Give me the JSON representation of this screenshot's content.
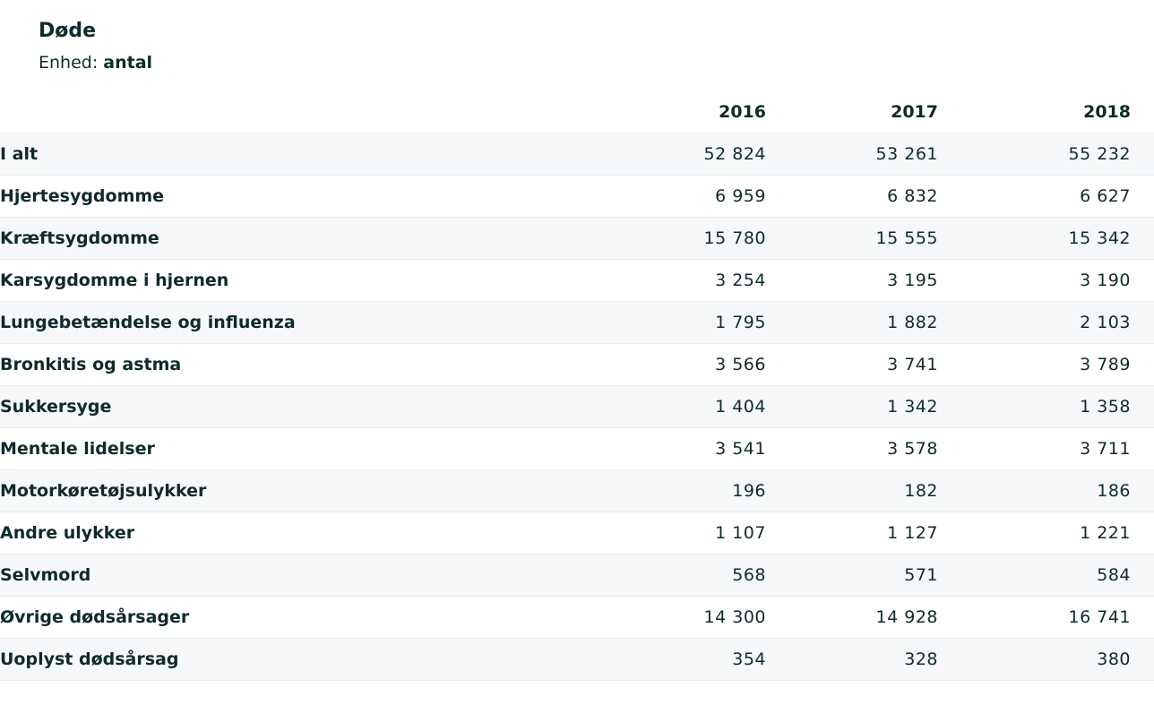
{
  "table": {
    "title": "Døde",
    "unit_label": "Enhed:",
    "unit_value": "antal",
    "columns": [
      "2016",
      "2017",
      "2018"
    ],
    "rows": [
      {
        "label": "I alt",
        "values": [
          "52 824",
          "53 261",
          "55 232"
        ]
      },
      {
        "label": "Hjertesygdomme",
        "values": [
          "6 959",
          "6 832",
          "6 627"
        ]
      },
      {
        "label": "Kræftsygdomme",
        "values": [
          "15 780",
          "15 555",
          "15 342"
        ]
      },
      {
        "label": "Karsygdomme i hjernen",
        "values": [
          "3 254",
          "3 195",
          "3 190"
        ]
      },
      {
        "label": "Lungebetændelse og influenza",
        "values": [
          "1 795",
          "1 882",
          "2 103"
        ]
      },
      {
        "label": "Bronkitis og astma",
        "values": [
          "3 566",
          "3 741",
          "3 789"
        ]
      },
      {
        "label": "Sukkersyge",
        "values": [
          "1 404",
          "1 342",
          "1 358"
        ]
      },
      {
        "label": "Mentale lidelser",
        "values": [
          "3 541",
          "3 578",
          "3 711"
        ]
      },
      {
        "label": "Motorkøretøjsulykker",
        "values": [
          "196",
          "182",
          "186"
        ]
      },
      {
        "label": "Andre ulykker",
        "values": [
          "1 107",
          "1 127",
          "1 221"
        ]
      },
      {
        "label": "Selvmord",
        "values": [
          "568",
          "571",
          "584"
        ]
      },
      {
        "label": "Øvrige dødsårsager",
        "values": [
          "14 300",
          "14 928",
          "16 741"
        ]
      },
      {
        "label": "Uoplyst dødsårsag",
        "values": [
          "354",
          "328",
          "380"
        ]
      }
    ]
  }
}
